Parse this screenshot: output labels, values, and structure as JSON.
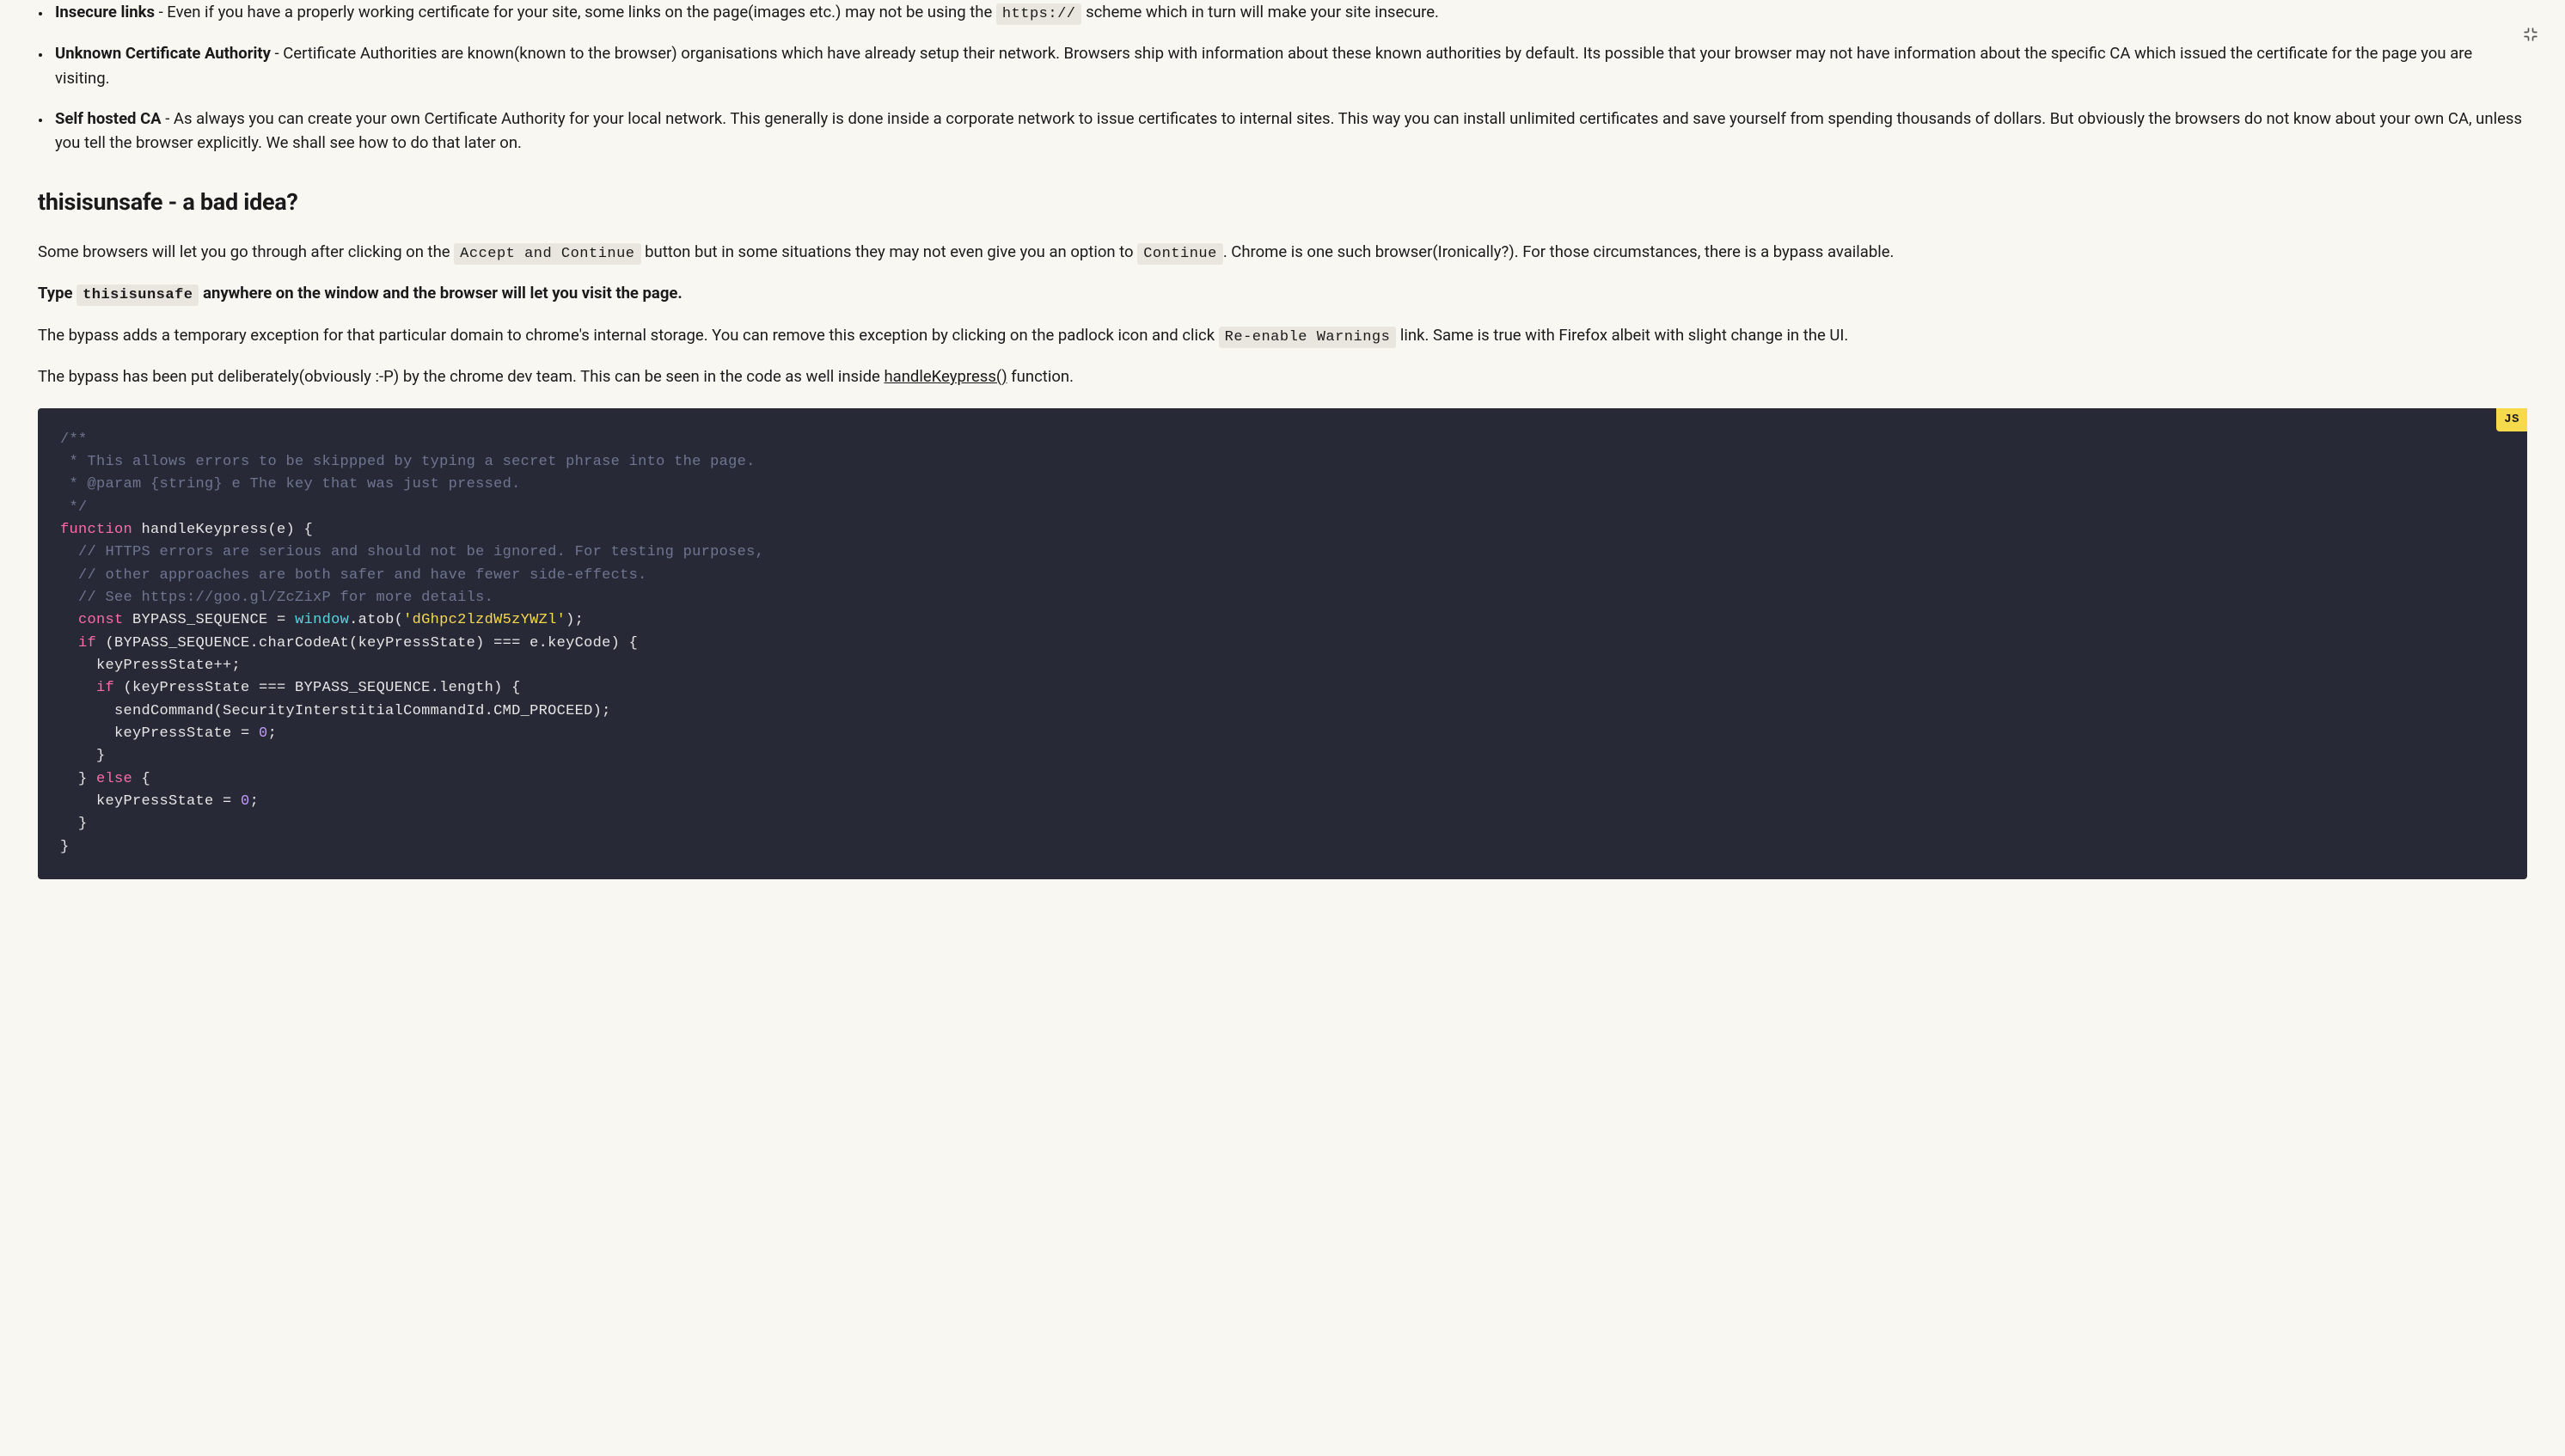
{
  "reasons": [
    {
      "term": "Insecure links",
      "desc_prefix": " - Even if you have a properly working certificate for your site, some links on the page(images etc.) may not be using the ",
      "code": "https://",
      "desc_suffix": " scheme which in turn will make your site insecure."
    },
    {
      "term": "Unknown Certificate Authority",
      "desc": " - Certificate Authorities are known(known to the browser) organisations which have already setup their network. Browsers ship with information about these known authorities by default. Its possible that your browser may not have information about the specific CA which issued the certificate for the page you are visiting."
    },
    {
      "term": "Self hosted CA",
      "desc": " - As always you can create your own Certificate Authority for your local network. This generally is done inside a corporate network to issue certificates to internal sites. This way you can install unlimited certificates and save yourself from spending thousands of dollars. But obviously the browsers do not know about your own CA, unless you tell the browser explicitly. We shall see how to do that later on."
    }
  ],
  "heading": "thisisunsafe - a bad idea?",
  "p1": {
    "t1": "Some browsers will let you go through after clicking on the ",
    "code1": "Accept and Continue",
    "t2": " button but in some situations they may not even give you an option to ",
    "code2": "Continue",
    "t3": ". Chrome is one such browser(Ironically?). For those circumstances, there is a bypass available."
  },
  "p2": {
    "t1": "Type ",
    "code": "thisisunsafe",
    "t2": " anywhere on the window and the browser will let you visit the page."
  },
  "p3": {
    "t1": "The bypass adds a temporary exception for that particular domain to chrome's internal storage. You can remove this exception by clicking on the padlock icon and click ",
    "code": "Re-enable Warnings",
    "t2": " link. Same is true with Firefox albeit with slight change in the UI."
  },
  "p4": {
    "t1": "The bypass has been put deliberately(obviously :-P) by the chrome dev team. This can be seen in the code as well inside ",
    "link": "handleKeypress()",
    "t2": " function."
  },
  "code_lang": "JS",
  "code": {
    "c1": "/**",
    "c2": " * This allows errors to be skippped by typing a secret phrase into the page.",
    "c3": " * @param {string} e The key that was just pressed.",
    "c4": " */",
    "l1_fn": "function",
    "l1_rest": " handleKeypress(e) {",
    "l2": "  // HTTPS errors are serious and should not be ignored. For testing purposes,",
    "l3": "  // other approaches are both safer and have fewer side-effects.",
    "l4": "  // See https://goo.gl/ZcZixP for more details.",
    "l5_const": "  const",
    "l5_a": " BYPASS_SEQUENCE = ",
    "l5_win": "window",
    "l5_b": ".atob(",
    "l5_str": "'dGhpc2lzdW5zYWZl'",
    "l5_c": ");",
    "l6_if": "  if",
    "l6_rest": " (BYPASS_SEQUENCE.charCodeAt(keyPressState) === e.keyCode) {",
    "l7": "    keyPressState++;",
    "l8_if": "    if",
    "l8_rest": " (keyPressState === BYPASS_SEQUENCE.length) {",
    "l9": "      sendCommand(SecurityInterstitialCommandId.CMD_PROCEED);",
    "l10_a": "      keyPressState = ",
    "l10_num": "0",
    "l10_b": ";",
    "l11": "    }",
    "l12_a": "  } ",
    "l12_else": "else",
    "l12_b": " {",
    "l13_a": "    keyPressState = ",
    "l13_num": "0",
    "l13_b": ";",
    "l14": "  }",
    "l15": "}"
  }
}
